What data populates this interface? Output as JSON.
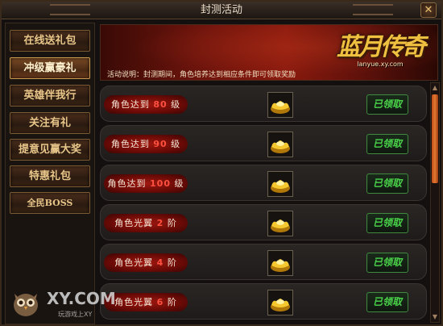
{
  "window": {
    "title": "封测活动",
    "close_label": "✕"
  },
  "sidebar": {
    "items": [
      {
        "label": "在线送礼包",
        "active": false
      },
      {
        "label": "冲级赢豪礼",
        "active": true
      },
      {
        "label": "英雄伴我行",
        "active": false
      },
      {
        "label": "关注有礼",
        "active": false
      },
      {
        "label": "提意见赢大奖",
        "active": false
      },
      {
        "label": "特惠礼包",
        "active": false
      },
      {
        "label": "全民BOSS",
        "active": false
      }
    ]
  },
  "banner": {
    "description": "活动说明：封测期间，角色培养达到相应条件即可领取奖励",
    "logo_text": "蓝月传奇",
    "logo_url": "lanyue.xy.com"
  },
  "rewards": {
    "rows": [
      {
        "prefix": "角色达到",
        "value": "80",
        "suffix": "级",
        "icon": "gold-ingot-icon",
        "status": "已领取"
      },
      {
        "prefix": "角色达到",
        "value": "90",
        "suffix": "级",
        "icon": "gold-ingot-icon",
        "status": "已领取"
      },
      {
        "prefix": "角色达到",
        "value": "100",
        "suffix": "级",
        "icon": "gold-ingot-icon",
        "status": "已领取"
      },
      {
        "prefix": "角色光翼",
        "value": "2",
        "suffix": "阶",
        "icon": "gold-ingot-icon",
        "status": "已领取"
      },
      {
        "prefix": "角色光翼",
        "value": "4",
        "suffix": "阶",
        "icon": "gold-ingot-icon",
        "status": "已领取"
      },
      {
        "prefix": "角色光翼",
        "value": "6",
        "suffix": "阶",
        "icon": "gold-ingot-icon",
        "status": "已领取"
      }
    ]
  },
  "watermark": {
    "brand": "XY.COM",
    "sub": "玩游戏上XY",
    "icon": "owl-icon"
  },
  "colors": {
    "accent_gold": "#e8c68a",
    "status_green": "#4ad44a",
    "level_red": "#ff5040",
    "banner_red": "#8a1a0e"
  }
}
